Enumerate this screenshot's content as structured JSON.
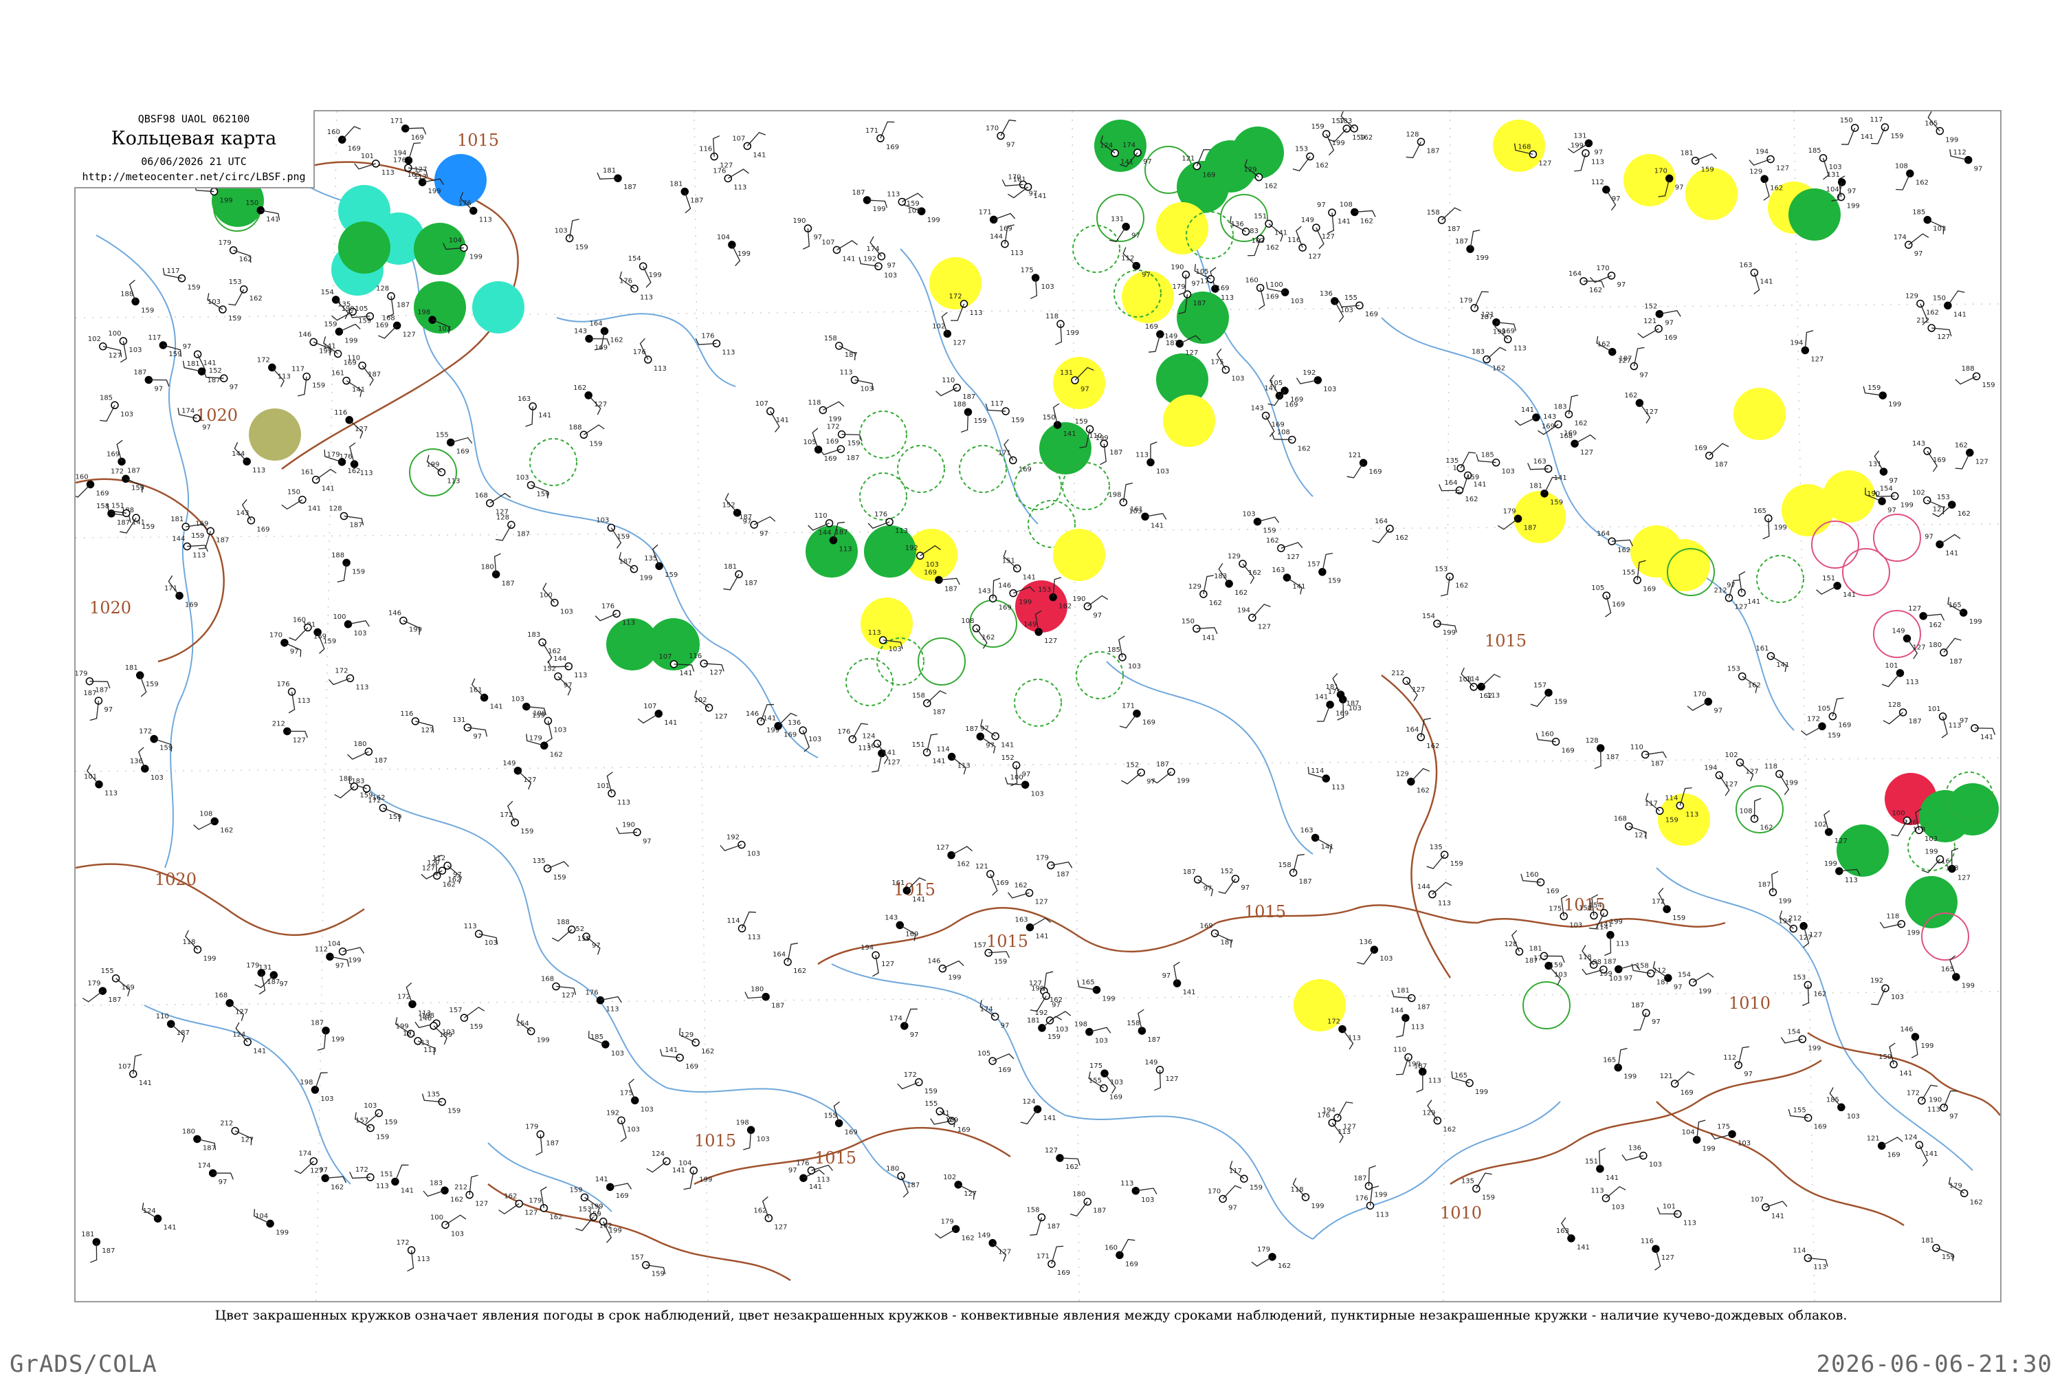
{
  "header": {
    "code_line": "QBSF98  UAOL  062100",
    "title": "Кольцевая карта",
    "date_line": "06/06/2026 21 UTC",
    "url": "http://meteocenter.net/circ/LBSF.png"
  },
  "caption": "Цвет закрашенных кружков означает явления погоды в срок наблюдений, цвет незакрашенных кружков - конвективные явления между сроками наблюдений, пунктирные незакрашенные кружки - наличие кучево-дождевых облаков.",
  "footer": {
    "left": "GrADS/COLA",
    "right": "2026-06-06-21:30"
  },
  "isobar_labels": [
    "1015",
    "1020",
    "1020",
    "1020",
    "1015",
    "1015",
    "1015",
    "1015",
    "1015",
    "1015",
    "1015",
    "1010",
    "1010"
  ],
  "colors": {
    "isobar": "#a0522d",
    "rivers": "#6fa8dc",
    "green_fill": "#1db33c",
    "yellow_fill": "#ffff33",
    "red_fill": "#e8264a",
    "blue_fill": "#1e90ff",
    "cyan_fill": "#33e6c8",
    "olive_fill": "#b5b56a",
    "convective_outline": "#33aa33",
    "cb_dashed_outline": "#33aa33",
    "pink_outline": "#e05080"
  },
  "station_numbers": [
    "152",
    "158",
    "129",
    "97",
    "155",
    "165",
    "181",
    "168",
    "172",
    "198",
    "187",
    "179",
    "183",
    "161",
    "171",
    "154",
    "172",
    "162",
    "176",
    "185",
    "174",
    "180",
    "153",
    "150",
    "141",
    "187",
    "188",
    "194",
    "176",
    "175",
    "170",
    "169",
    "164",
    "151",
    "143",
    "146",
    "135",
    "212",
    "199",
    "192",
    "190",
    "181",
    "179",
    "163",
    "160",
    "159",
    "157",
    "149",
    "144",
    "136",
    "131",
    "128",
    "127",
    "124",
    "121",
    "118",
    "117",
    "116",
    "114",
    "113",
    "112",
    "110",
    "108",
    "107",
    "105",
    "104",
    "103",
    "102",
    "101",
    "100"
  ]
}
